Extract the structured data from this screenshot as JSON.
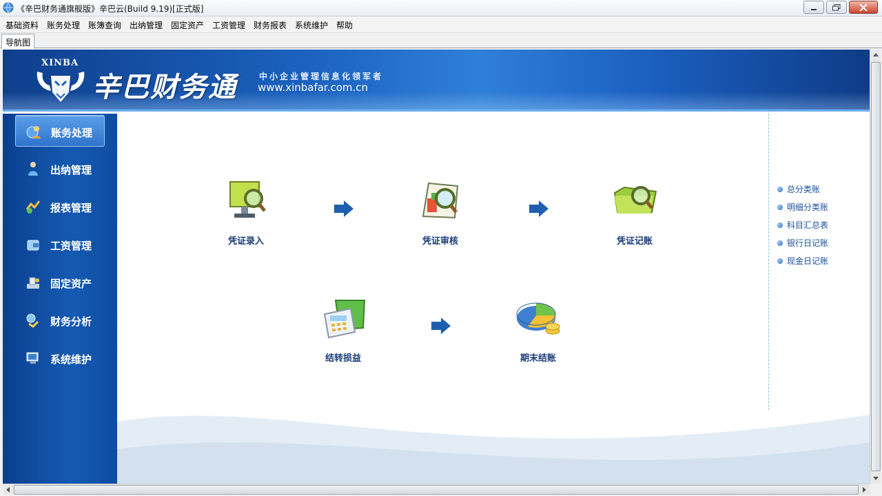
{
  "window": {
    "title": "《辛巴财务通旗舰版》辛巴云(Build 9.19)[正式版]",
    "icon": "app-globe-icon"
  },
  "menu": [
    "基础资料",
    "账务处理",
    "账簿查询",
    "出纳管理",
    "固定资产",
    "工资管理",
    "财务报表",
    "系统维护",
    "帮助"
  ],
  "tabs": [
    "导航图"
  ],
  "banner": {
    "brand_en": "XINBA",
    "brand_cn": "辛巴财务通",
    "slogan": "中小企业管理信息化领军者",
    "url": "www.xinbafar.com.cn"
  },
  "sidebar": {
    "items": [
      {
        "label": "账务处理",
        "icon": "globe-user-icon",
        "active": true
      },
      {
        "label": "出纳管理",
        "icon": "person-icon",
        "active": false
      },
      {
        "label": "报表管理",
        "icon": "chart-icon",
        "active": false
      },
      {
        "label": "工资管理",
        "icon": "wallet-icon",
        "active": false
      },
      {
        "label": "固定资产",
        "icon": "asset-icon",
        "active": false
      },
      {
        "label": "财务分析",
        "icon": "analysis-icon",
        "active": false
      },
      {
        "label": "系统维护",
        "icon": "monitor-icon",
        "active": false
      }
    ]
  },
  "workflow": {
    "steps": [
      {
        "label": "凭证录入",
        "icon": "monitor-magnifier-icon"
      },
      {
        "label": "凭证审核",
        "icon": "chart-magnifier-icon"
      },
      {
        "label": "凭证记账",
        "icon": "folder-magnifier-icon"
      },
      {
        "label": "结转损益",
        "icon": "calculator-folder-icon"
      },
      {
        "label": "期末结账",
        "icon": "pie-coins-icon"
      }
    ]
  },
  "quick_links": [
    "总分类账",
    "明细分类账",
    "科目汇总表",
    "银行日记账",
    "现金日记账"
  ],
  "colors": {
    "banner": "#1b62bf",
    "sidebar": "#155ab2",
    "label": "#1a3c78",
    "link": "#1a4f9c"
  }
}
